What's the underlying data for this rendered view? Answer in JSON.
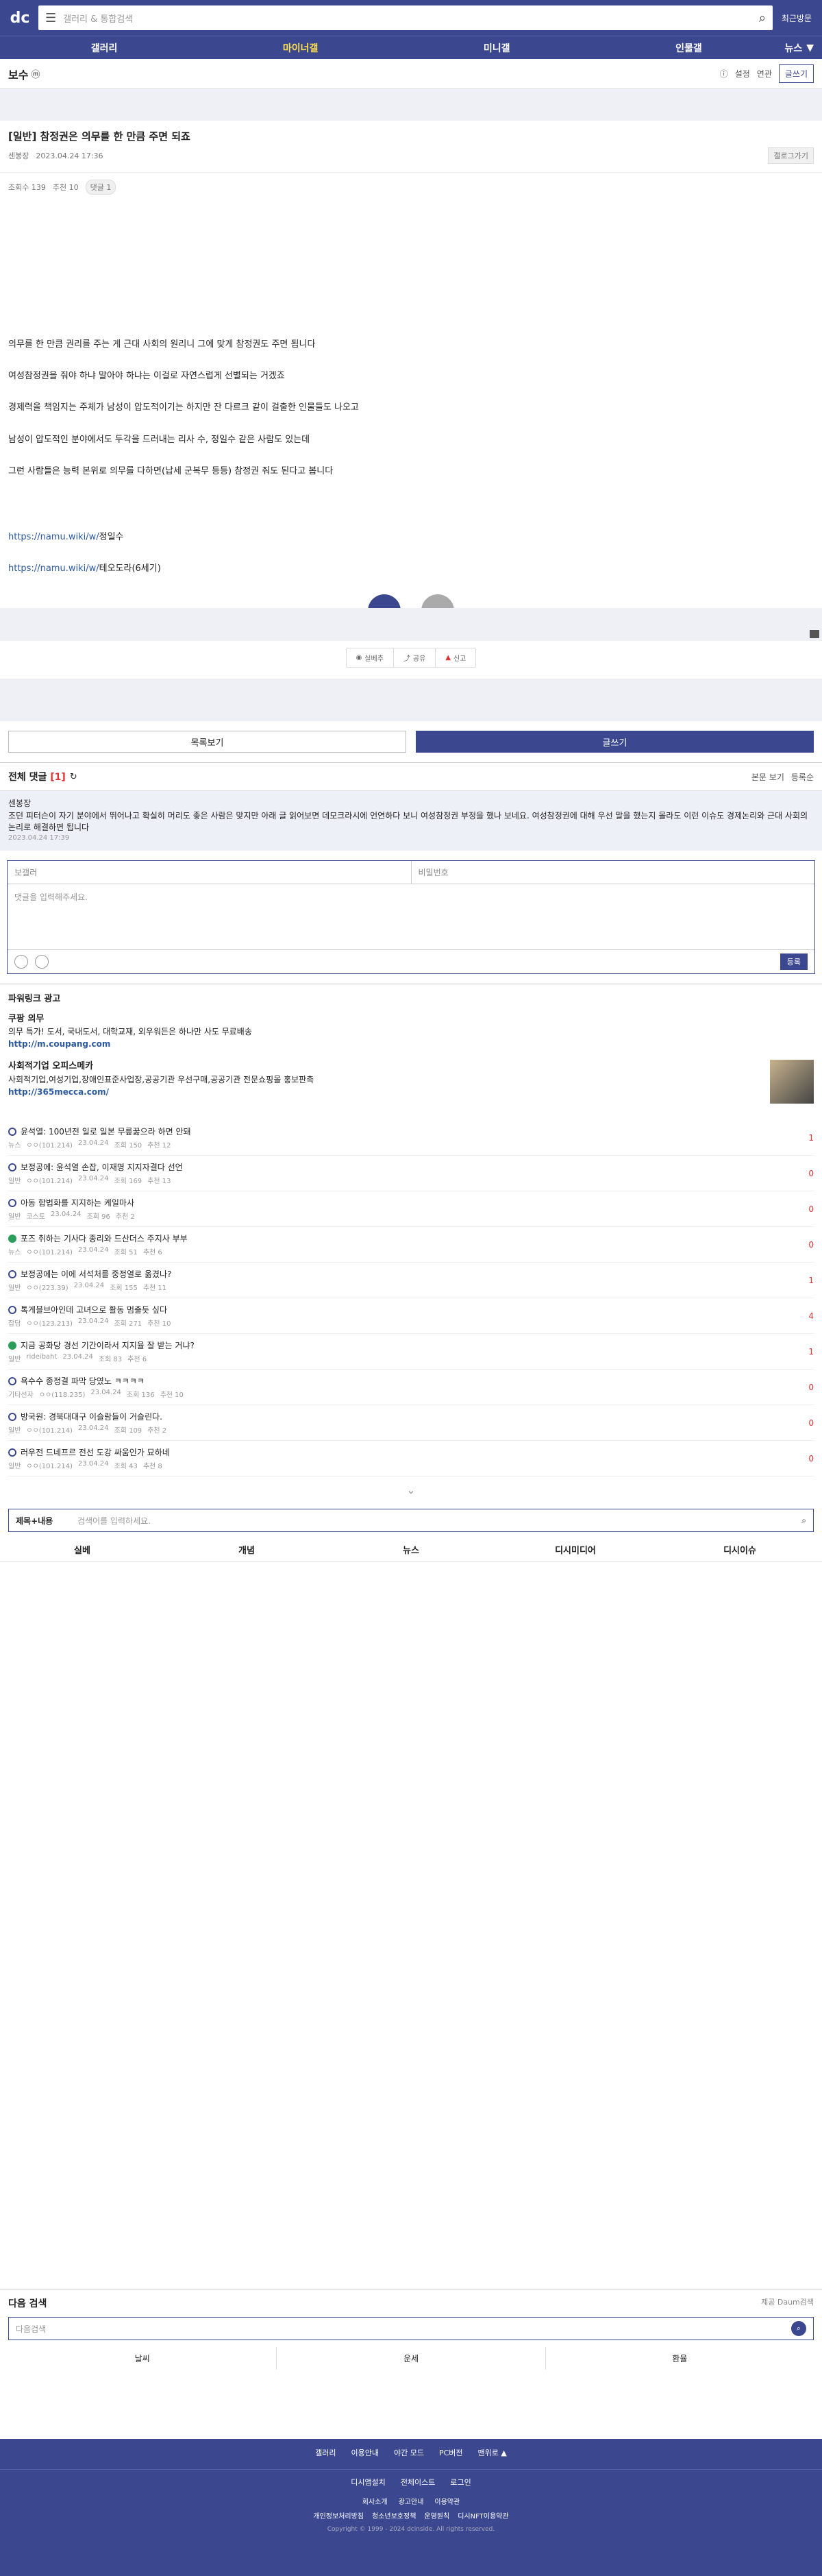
{
  "header": {
    "logo": "dc",
    "search_placeholder": "갤러리 & 통합검색",
    "recent_label": "최근방문"
  },
  "nav": {
    "items": [
      "갤러리",
      "마이너갤",
      "미니갤",
      "인물갤"
    ],
    "news": "뉴스"
  },
  "gallery": {
    "name": "보수",
    "badge": "ⓜ",
    "setting": "설정",
    "related": "연관",
    "write": "글쓰기"
  },
  "post": {
    "title": "[일반] 참정권은 의무를 한 만큼 주면 되죠",
    "author": "센봉장",
    "date": "2023.04.24 17:36",
    "list_btn": "갤로그가기",
    "views": "조회수 139",
    "recommend": "추천 10",
    "comment_badge": "댓글 1"
  },
  "body": {
    "lines": [
      "의무를 한 만큼 권리를 주는 게 근대 사회의 원리니 그에 맞게 참정권도 주면 됩니다",
      "여성참정권을 줘야 하냐 말아야 하냐는 이걸로 자연스럽게 선별되는 거겠죠",
      "경제력을 책임지는 주체가 남성이 압도적이기는 하지만 잔 다르크 같이 걸출한 인물들도 나오고",
      "남성이 압도적인 분야에서도 두각을 드러내는 리사 수, 정일수 같은 사람도 있는데",
      "그런 사람들은 능력 본위로 의무를 다하면(납세 군복무 등등) 참정권 줘도 된다고 봅니다"
    ],
    "link1_url": "https://namu.wiki/w/",
    "link1_text": "정일수",
    "link2_url": "https://namu.wiki/w/",
    "link2_text": "테오도라(6세기)"
  },
  "share": {
    "items": [
      "실베추",
      "공유",
      "신고"
    ]
  },
  "buttons": {
    "list": "목록보기",
    "write": "글쓰기"
  },
  "comments": {
    "title": "전체 댓글",
    "count": "[1]",
    "sort1": "본문 보기",
    "sort2": "등록순",
    "nick": "센봉장",
    "text": "조던 피터슨이 자기 분야에서 뛰어나고 확실히 머리도 좋은 사람은 맞지만 아래 글 읽어보면 데모크라시에 언연하다 보니 여성참정권 부정을 했나 보네요. 여성참정권에 대해 우선 말을 했는지 몰라도 이런 이슈도 경제논리와 근대 사회의 논리로 해결하면 됩니다",
    "date": "2023.04.24 17:39"
  },
  "form": {
    "nick": "보갤러",
    "pw": "비밀번호",
    "placeholder": "댓글을 입력해주세요.",
    "submit": "등록"
  },
  "powerlink": {
    "title": "파워링크 광고",
    "ads": [
      {
        "name": "쿠팡 의무",
        "desc": "의무 특가! 도서, 국내도서, 대학교재, 외우워든은 하나만 사도 무료배송",
        "url": "http://m.coupang.com"
      },
      {
        "name": "사회적기업 오피스메카",
        "desc": "사회적기업,여성기업,장애인표준사업장,공공기관 우선구매,공공기관 전문쇼핑몰 홍보판촉",
        "url": "http://365mecca.com/"
      }
    ]
  },
  "list": [
    {
      "title": "윤석열: 100년전 일로 일본 무릎꿇으라 하면 안돼",
      "cat": "뉴스",
      "user": "ㅇㅇ(101.214)",
      "date": "23.04.24",
      "views": "조회 150",
      "rec": "추천 12",
      "n": "1"
    },
    {
      "title": "보정공에: 윤석열 손잡, 이재명 지지자결다 선언",
      "cat": "일반",
      "user": "ㅇㅇ(101.214)",
      "date": "23.04.24",
      "views": "조회 169",
      "rec": "추천 13",
      "n": "0"
    },
    {
      "title": "아동 합법화를 지지하는 케일마사",
      "cat": "일반",
      "user": "코스토",
      "date": "23.04.24",
      "views": "조회 96",
      "rec": "추천 2",
      "n": "0"
    },
    {
      "title": "포즈 취하는 기사다 종리와 드산더스 주지사 부부",
      "cat": "뉴스",
      "user": "ㅇㅇ(101.214)",
      "date": "23.04.24",
      "views": "조회 51",
      "rec": "추천 6",
      "n": "0"
    },
    {
      "title": "보정공에는 이에 서석처를 중정열로 옮겼나?",
      "cat": "일반",
      "user": "ㅇㅇ(223.39)",
      "date": "23.04.24",
      "views": "조회 155",
      "rec": "추천 11",
      "n": "1"
    },
    {
      "title": "톡게블브아인데 고녀으로 활동 멈출듯 싶다",
      "cat": "잡담",
      "user": "ㅇㅇ(123.213)",
      "date": "23.04.24",
      "views": "조회 271",
      "rec": "추천 10",
      "n": "4"
    },
    {
      "title": "지금 공화당 경선 기간이라서 지지율 잘 받는 거냐?",
      "cat": "일반",
      "user": "rideibaht",
      "date": "23.04.24",
      "views": "조회 83",
      "rec": "추천 6",
      "n": "1"
    },
    {
      "title": "욕수수 종정결 파막 당였노 ㅋㅋㅋㅋ",
      "cat": "기타선자",
      "user": "ㅇㅇ(118.235)",
      "date": "23.04.24",
      "views": "조회 136",
      "rec": "추천 10",
      "n": "0"
    },
    {
      "title": "방국원: 경북대대구 이슬람들이 거슬린다.",
      "cat": "일반",
      "user": "ㅇㅇ(101.214)",
      "date": "23.04.24",
      "views": "조회 109",
      "rec": "추천 2",
      "n": "0"
    },
    {
      "title": "러우전 드네프르 전선 도강 싸움인가 묘하네",
      "cat": "일반",
      "user": "ㅇㅇ(101.214)",
      "date": "23.04.24",
      "views": "조회 43",
      "rec": "추천 8",
      "n": "0"
    }
  ],
  "search2": {
    "select": "제목+내용",
    "placeholder": "검색어를 입력하세요."
  },
  "tabs": [
    "실베",
    "개념",
    "뉴스",
    "디시미디어",
    "디시이슈"
  ],
  "next": {
    "title": "다음 검색",
    "right": "제공 Daum검색",
    "placeholder": "다음검색",
    "tabs": [
      "날씨",
      "운세",
      "환율"
    ]
  },
  "footer": {
    "r1": [
      "갤러리",
      "이용안내",
      "야간 모드",
      "PC버전",
      "맨위로 ▲"
    ],
    "r2": [
      "디시앱설치",
      "전체이스트",
      "로그인"
    ],
    "r3": [
      "회사소개",
      "광고안내",
      "이용약관"
    ],
    "r4": [
      "개인정보처리방침",
      "청소년보호정책",
      "운영원칙",
      "디시NFT이용약관"
    ],
    "copy": "Copyright © 1999 - 2024 dcinside. All rights reserved."
  }
}
